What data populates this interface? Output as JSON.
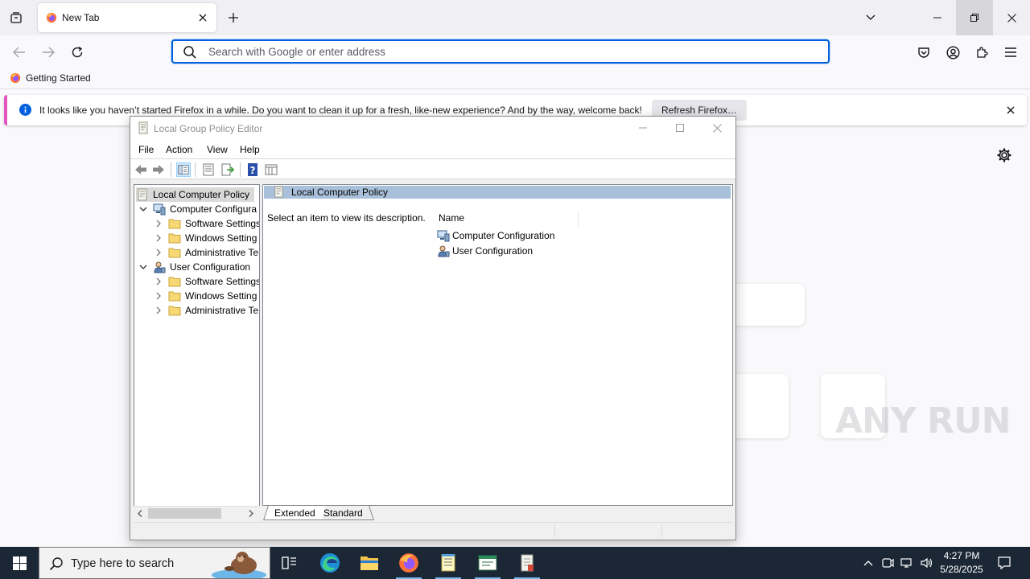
{
  "browser": {
    "tab_title": "New Tab",
    "urlbar_placeholder": "Search with Google or enter address",
    "bookmark": "Getting Started",
    "notification": {
      "message": "It looks like you haven’t started Firefox in a while. Do you want to clean it up for a fresh, like-new experience? And by the way, welcome back!",
      "button": "Refresh Firefox…"
    }
  },
  "gpe": {
    "title": "Local Group Policy Editor",
    "menu": [
      "File",
      "Action",
      "View",
      "Help"
    ],
    "tree": {
      "root": "Local Computer Policy",
      "computer_config": "Computer Configura",
      "user_config": "User Configuration",
      "computer_children": [
        "Software Settings",
        "Windows Setting",
        "Administrative Te"
      ],
      "user_children": [
        "Software Settings",
        "Windows Setting",
        "Administrative Te"
      ]
    },
    "right_pane": {
      "header": "Local Computer Policy",
      "description": "Select an item to view its description.",
      "column_name": "Name",
      "items": [
        "Computer Configuration",
        "User Configuration"
      ]
    },
    "view_tabs": [
      "Extended",
      "Standard"
    ]
  },
  "taskbar": {
    "search_placeholder": "Type here to search",
    "time": "4:27 PM",
    "date": "5/28/2025",
    "apps": [
      "task-view",
      "edge",
      "file-explorer",
      "firefox",
      "notepad",
      "terminal-window",
      "group-policy"
    ]
  },
  "watermark": "ANY RUN",
  "colors": {
    "urlbar_focus": "#0061e0",
    "notification_accent": "#e356c0",
    "gpe_header": "#a9c0da",
    "taskbar_bg": "#1b2735"
  }
}
